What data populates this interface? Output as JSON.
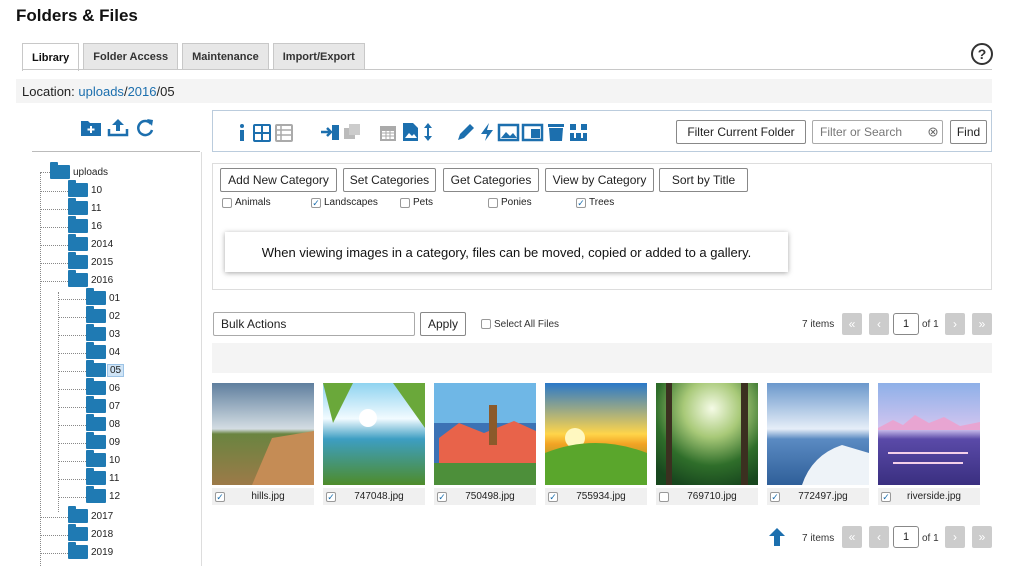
{
  "page_title": "Folders & Files",
  "tabs": [
    {
      "label": "Library",
      "active": true
    },
    {
      "label": "Folder Access",
      "active": false
    },
    {
      "label": "Maintenance",
      "active": false
    },
    {
      "label": "Import/Export",
      "active": false
    }
  ],
  "help_label": "?",
  "location": {
    "label": "Location:",
    "parts": [
      "uploads",
      "2016",
      "05"
    ],
    "sep": "/"
  },
  "tree": {
    "root": "uploads",
    "folders": [
      "10",
      "11",
      "16",
      "2014",
      "2015",
      "2016",
      "01",
      "02",
      "03",
      "04",
      "05",
      "06",
      "07",
      "08",
      "09",
      "10",
      "11",
      "12",
      "2017",
      "2018",
      "2019"
    ],
    "selected": "05"
  },
  "toolbar": {
    "filter_button": "Filter Current Folder",
    "search_placeholder": "Filter or Search",
    "find_button": "Find"
  },
  "categories": {
    "buttons": [
      "Add New Category",
      "Set Categories",
      "Get Categories",
      "View by Category",
      "Sort by Title"
    ],
    "items": [
      {
        "label": "Animals",
        "checked": false
      },
      {
        "label": "Landscapes",
        "checked": true
      },
      {
        "label": "Pets",
        "checked": false
      },
      {
        "label": "Ponies",
        "checked": false
      },
      {
        "label": "Trees",
        "checked": true
      }
    ],
    "note": "When viewing images in a category, files can be moved, copied or added to a gallery."
  },
  "bulk": {
    "select_label": "Bulk Actions",
    "apply": "Apply",
    "select_all": "Select All Files"
  },
  "pagination": {
    "count": "7 items",
    "current": "1",
    "of": "of 1",
    "first": "«",
    "prev": "‹",
    "next": "›",
    "last": "»"
  },
  "files": [
    {
      "name": "hills.jpg",
      "checked": true,
      "colors": [
        "#7a98b5",
        "#c7d6df",
        "#5f7a3a",
        "#b57d4e"
      ]
    },
    {
      "name": "747048.jpg",
      "checked": true,
      "colors": [
        "#8bd1ef",
        "#e9f6ff",
        "#2f8fb3",
        "#5a8a2c"
      ]
    },
    {
      "name": "750498.jpg",
      "checked": true,
      "colors": [
        "#6fb7e6",
        "#e8634a",
        "#3c72b5",
        "#8b5a2b"
      ]
    },
    {
      "name": "755934.jpg",
      "checked": true,
      "colors": [
        "#2a78c8",
        "#ffd54a",
        "#f2a324",
        "#4d9a29"
      ]
    },
    {
      "name": "769710.jpg",
      "checked": false,
      "colors": [
        "#d8e7bb",
        "#7eb05a",
        "#2f6e2a",
        "#18471e"
      ]
    },
    {
      "name": "772497.jpg",
      "checked": true,
      "colors": [
        "#7fa9d8",
        "#c6d8ef",
        "#4f7fb8",
        "#e9eef5"
      ]
    },
    {
      "name": "riverside.jpg",
      "checked": true,
      "colors": [
        "#8eb0e8",
        "#d2c5f0",
        "#6a5ab8",
        "#e8a5d2"
      ]
    }
  ]
}
